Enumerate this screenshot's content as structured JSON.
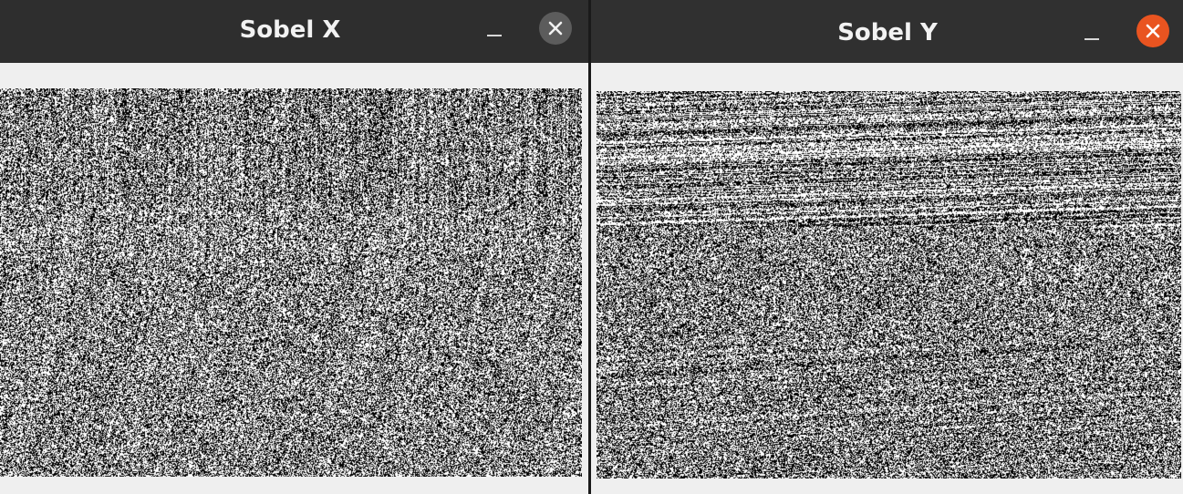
{
  "windows": [
    {
      "id": "sobel-x",
      "title": "Sobel X",
      "image_description_icon": "sobel-x-edge-map",
      "close_button_color": "#5c5c5c"
    },
    {
      "id": "sobel-y",
      "title": "Sobel Y",
      "image_description_icon": "sobel-y-edge-map",
      "close_button_color": "#e95420"
    }
  ],
  "colors": {
    "titlebar": "#2e2e2e",
    "window_bg": "#efefef",
    "close_active": "#e95420"
  }
}
